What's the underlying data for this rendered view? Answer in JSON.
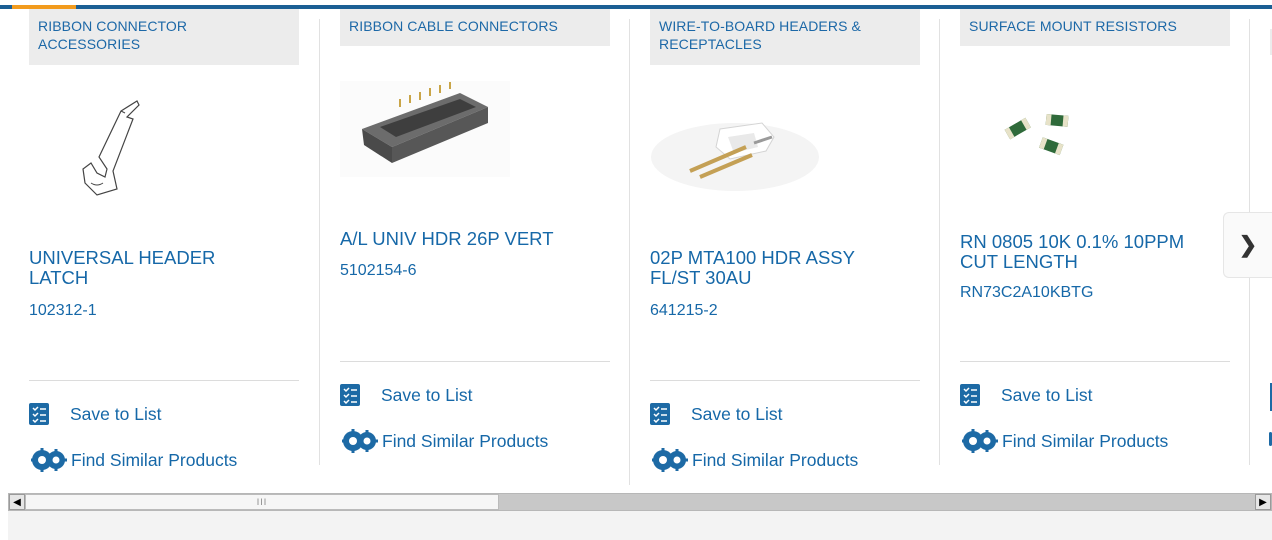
{
  "products": [
    {
      "category": "RIBBON CONNECTOR ACCESSORIES",
      "title": "UNIVERSAL HEADER LATCH",
      "part_number": "102312-1",
      "save_label": "Save to List",
      "similar_label": "Find Similar Products",
      "image_icon": "header-latch-drawing"
    },
    {
      "category": "RIBBON CABLE CONNECTORS",
      "title": "A/L UNIV HDR 26P VERT",
      "part_number": "5102154-6",
      "save_label": "Save to List",
      "similar_label": "Find Similar Products",
      "image_icon": "ribbon-cable-header"
    },
    {
      "category": "WIRE-TO-BOARD HEADERS & RECEPTACLES",
      "title": "02P MTA100 HDR ASSY FL/ST 30AU",
      "part_number": "641215-2",
      "save_label": "Save to List",
      "similar_label": "Find Similar Products",
      "image_icon": "wire-to-board-header"
    },
    {
      "category": "SURFACE MOUNT RESISTORS",
      "title": "RN 0805 10K 0.1% 10PPM CUT LENGTH",
      "part_number": "RN73C2A10KBTG",
      "save_label": "Save to List",
      "similar_label": "Find Similar Products",
      "image_icon": "smd-resistors"
    }
  ],
  "carousel": {
    "next_icon": "chevron-right-icon"
  },
  "colors": {
    "link": "#1668a8",
    "accent": "#1b5f94",
    "highlight": "#f29b1d",
    "category_bg": "#ececec"
  },
  "scrollbar": {
    "left_icon": "arrow-left-icon",
    "right_icon": "arrow-right-icon",
    "grip": "III"
  }
}
